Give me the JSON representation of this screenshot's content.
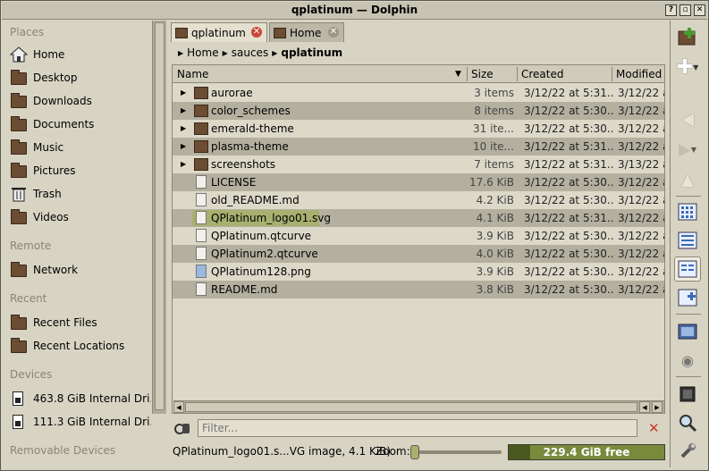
{
  "window": {
    "title": "qplatinum — Dolphin",
    "buttons": [
      "?",
      "▫",
      "✕"
    ]
  },
  "sidebar": {
    "sections": [
      {
        "label": "Places",
        "items": [
          {
            "label": "Home",
            "icon": "home-icon"
          },
          {
            "label": "Desktop",
            "icon": "desktop-icon"
          },
          {
            "label": "Downloads",
            "icon": "folder-icon"
          },
          {
            "label": "Documents",
            "icon": "folder-icon"
          },
          {
            "label": "Music",
            "icon": "folder-icon"
          },
          {
            "label": "Pictures",
            "icon": "folder-icon"
          },
          {
            "label": "Trash",
            "icon": "trash-icon"
          },
          {
            "label": "Videos",
            "icon": "folder-icon"
          }
        ]
      },
      {
        "label": "Remote",
        "items": [
          {
            "label": "Network",
            "icon": "folder-icon"
          }
        ]
      },
      {
        "label": "Recent",
        "items": [
          {
            "label": "Recent Files",
            "icon": "folder-icon"
          },
          {
            "label": "Recent Locations",
            "icon": "folder-icon"
          }
        ]
      },
      {
        "label": "Devices",
        "items": [
          {
            "label": "463.8 GiB Internal Dri...",
            "icon": "drive-icon"
          },
          {
            "label": "111.3 GiB Internal Dri...",
            "icon": "drive-icon"
          }
        ]
      },
      {
        "label": "Removable Devices",
        "items": []
      }
    ]
  },
  "tabs": [
    {
      "label": "qplatinum",
      "active": true
    },
    {
      "label": "Home",
      "active": false
    }
  ],
  "breadcrumb": [
    "Home",
    "sauces",
    "qplatinum"
  ],
  "columns": {
    "name": "Name",
    "size": "Size",
    "created": "Created",
    "modified": "Modified"
  },
  "files": [
    {
      "name": "aurorae",
      "size": "3 items",
      "created": "3/12/22 at 5:31...",
      "modified": "3/12/22 a",
      "type": "folder"
    },
    {
      "name": "color_schemes",
      "size": "8 items",
      "created": "3/12/22 at 5:30...",
      "modified": "3/12/22 a",
      "type": "folder"
    },
    {
      "name": "emerald-theme",
      "size": "31 ite...",
      "created": "3/12/22 at 5:30...",
      "modified": "3/12/22 a",
      "type": "folder"
    },
    {
      "name": "plasma-theme",
      "size": "10 ite...",
      "created": "3/12/22 at 5:31...",
      "modified": "3/12/22 a",
      "type": "folder"
    },
    {
      "name": "screenshots",
      "size": "7 items",
      "created": "3/12/22 at 5:31...",
      "modified": "3/13/22 a",
      "type": "folder"
    },
    {
      "name": "LICENSE",
      "size": "17.6 KiB",
      "created": "3/12/22 at 5:30...",
      "modified": "3/12/22 a",
      "type": "file"
    },
    {
      "name": "old_README.md",
      "size": "4.2 KiB",
      "created": "3/12/22 at 5:30...",
      "modified": "3/12/22 a",
      "type": "file"
    },
    {
      "name": "QPlatinum_logo01.svg",
      "size": "4.1 KiB",
      "created": "3/12/22 at 5:31...",
      "modified": "3/12/22 a",
      "type": "file",
      "selected": true
    },
    {
      "name": "QPlatinum.qtcurve",
      "size": "3.9 KiB",
      "created": "3/12/22 at 5:30...",
      "modified": "3/12/22 a",
      "type": "file"
    },
    {
      "name": "QPlatinum2.qtcurve",
      "size": "4.0 KiB",
      "created": "3/12/22 at 5:30...",
      "modified": "3/12/22 a",
      "type": "file"
    },
    {
      "name": "QPlatinum128.png",
      "size": "3.9 KiB",
      "created": "3/12/22 at 5:30...",
      "modified": "3/12/22 a",
      "type": "image"
    },
    {
      "name": "README.md",
      "size": "3.8 KiB",
      "created": "3/12/22 at 5:30...",
      "modified": "3/12/22 a",
      "type": "file"
    }
  ],
  "filter": {
    "placeholder": "Filter..."
  },
  "status": {
    "text": "QPlatinum_logo01.s...VG image, 4.1 KiB)",
    "zoom_label": "Zoom:",
    "free_space": "229.4 GiB free",
    "used_fraction": 0.14
  },
  "toolbar": [
    "new-folder-icon",
    "new-tab-icon",
    "back-icon",
    "forward-icon",
    "up-icon",
    "icons-view-icon",
    "details-view-icon",
    "compact-view-icon",
    "split-view-icon",
    "preview-icon",
    "hidden-files-icon",
    "terminal-icon",
    "search-icon",
    "settings-icon"
  ],
  "colors": {
    "selection": "#a8b070",
    "folder": "#6b4d34",
    "free_bar": "#4a5a1e"
  }
}
